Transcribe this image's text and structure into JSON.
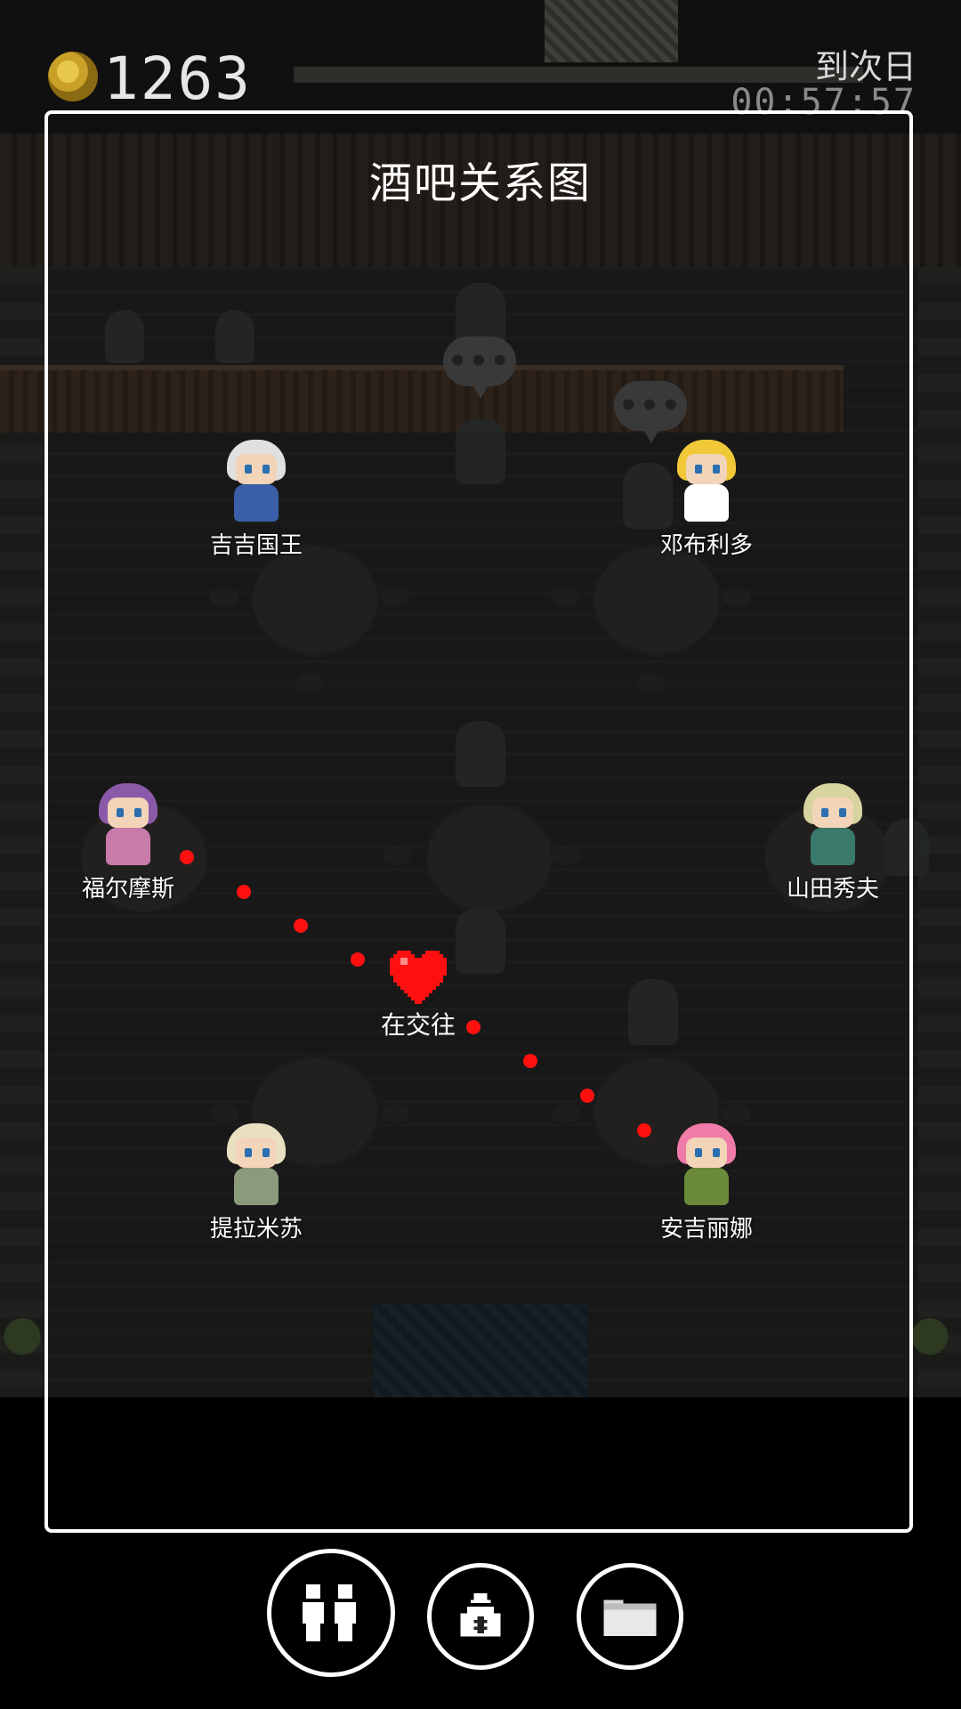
{
  "hud": {
    "coin_icon": "gold-coin-icon",
    "coins": "1263",
    "next_day_label": "到次日",
    "next_day_timer": "00:57:57"
  },
  "panel": {
    "title": "酒吧关系图"
  },
  "characters": [
    {
      "name": "吉吉国王",
      "hair": "#e0e0e0",
      "body": "#3a5fa8"
    },
    {
      "name": "邓布利多",
      "hair": "#f0c838",
      "body": "#ffffff"
    },
    {
      "name": "福尔摩斯",
      "hair": "#8a5aa8",
      "body": "#c87aa8"
    },
    {
      "name": "山田秀夫",
      "hair": "#d8d4a0",
      "body": "#3a7a6a"
    },
    {
      "name": "提拉米苏",
      "hair": "#e8e0c0",
      "body": "#8a9a7a"
    },
    {
      "name": "安吉丽娜",
      "hair": "#f07aa8",
      "body": "#6a8a3a"
    }
  ],
  "relationship": {
    "status": "在交往",
    "icon": "heart-icon",
    "color": "#ff1010"
  },
  "bubbles": [
    "•••",
    "•••"
  ],
  "bottom_bar": {
    "buttons": [
      {
        "icon": "people-icon"
      },
      {
        "icon": "money-bag-icon"
      },
      {
        "icon": "folder-icon"
      }
    ]
  }
}
